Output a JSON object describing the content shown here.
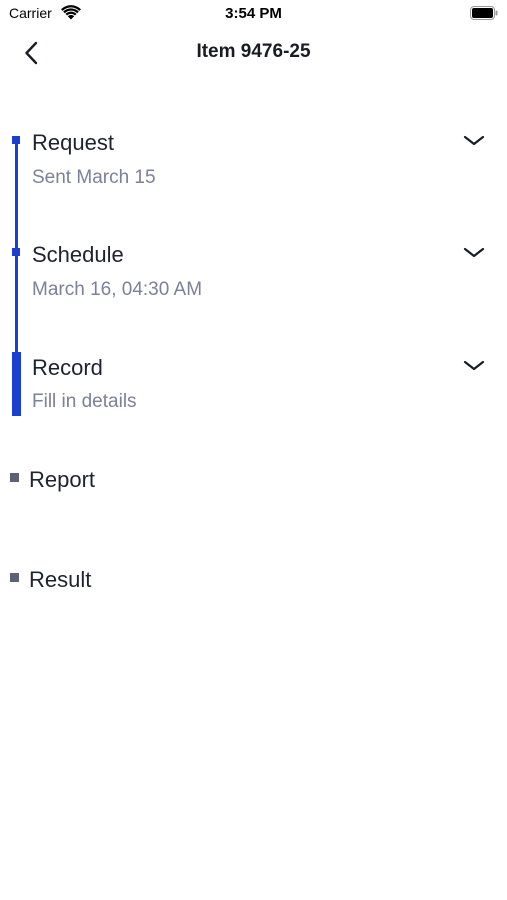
{
  "status_bar": {
    "carrier": "Carrier",
    "time": "3:54 PM"
  },
  "nav": {
    "title": "Item 9476-25",
    "back_icon": "chevron-left-icon"
  },
  "colors": {
    "accent": "#1b3fd1",
    "inactive": "#5d6178",
    "subtitle": "#7c8099"
  },
  "steps": [
    {
      "title": "Request",
      "subtitle": "Sent March 15",
      "state": "done",
      "expandable": true
    },
    {
      "title": "Schedule",
      "subtitle": "March 16, 04:30 AM",
      "state": "done",
      "expandable": true
    },
    {
      "title": "Record",
      "subtitle": "Fill in details",
      "state": "current",
      "expandable": true
    },
    {
      "title": "Report",
      "subtitle": "",
      "state": "pending",
      "expandable": false
    },
    {
      "title": "Result",
      "subtitle": "",
      "state": "pending",
      "expandable": false
    }
  ]
}
